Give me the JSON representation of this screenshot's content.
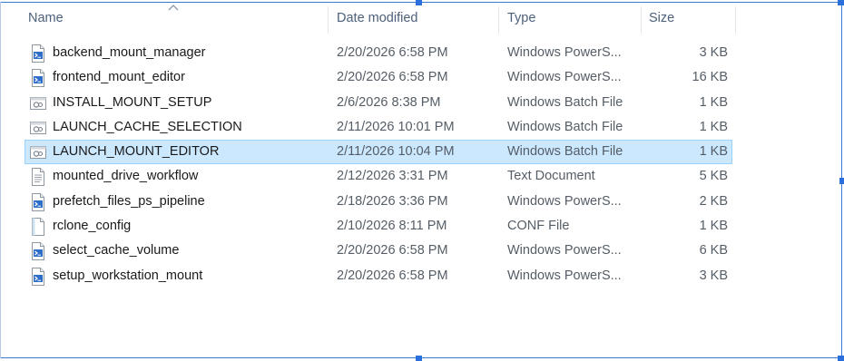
{
  "columns": {
    "name": "Name",
    "date": "Date modified",
    "type": "Type",
    "size": "Size"
  },
  "sort": {
    "column": "name",
    "icon": "sort-ascending-chevron-icon"
  },
  "files": [
    {
      "name": "backend_mount_manager",
      "date": "2/20/2026 6:58 PM",
      "type": "Windows PowerS...",
      "size": "3 KB",
      "icon": "powershell-script-icon"
    },
    {
      "name": "frontend_mount_editor",
      "date": "2/20/2026 6:58 PM",
      "type": "Windows PowerS...",
      "size": "16 KB",
      "icon": "powershell-script-icon"
    },
    {
      "name": "INSTALL_MOUNT_SETUP",
      "date": "2/6/2026 8:38 PM",
      "type": "Windows Batch File",
      "size": "1 KB",
      "icon": "batch-file-icon"
    },
    {
      "name": "LAUNCH_CACHE_SELECTION",
      "date": "2/11/2026 10:01 PM",
      "type": "Windows Batch File",
      "size": "1 KB",
      "icon": "batch-file-icon"
    },
    {
      "name": "LAUNCH_MOUNT_EDITOR",
      "date": "2/11/2026 10:04 PM",
      "type": "Windows Batch File",
      "size": "1 KB",
      "icon": "batch-file-icon",
      "selected": true
    },
    {
      "name": "mounted_drive_workflow",
      "date": "2/12/2026 3:31 PM",
      "type": "Text Document",
      "size": "5 KB",
      "icon": "text-document-icon"
    },
    {
      "name": "prefetch_files_ps_pipeline",
      "date": "2/18/2026 3:36 PM",
      "type": "Windows PowerS...",
      "size": "2 KB",
      "icon": "powershell-script-icon"
    },
    {
      "name": "rclone_config",
      "date": "2/10/2026 8:11 PM",
      "type": "CONF File",
      "size": "1 KB",
      "icon": "conf-file-icon"
    },
    {
      "name": "select_cache_volume",
      "date": "2/20/2026 6:58 PM",
      "type": "Windows PowerS...",
      "size": "6 KB",
      "icon": "powershell-script-icon"
    },
    {
      "name": "setup_workstation_mount",
      "date": "2/20/2026 6:58 PM",
      "type": "Windows PowerS...",
      "size": "3 KB",
      "icon": "powershell-script-icon"
    }
  ],
  "colors": {
    "selection_fill": "#cce8ff",
    "selection_border": "#99d1ff",
    "header_text": "#4c607a",
    "frame": "#3c7ad8"
  }
}
